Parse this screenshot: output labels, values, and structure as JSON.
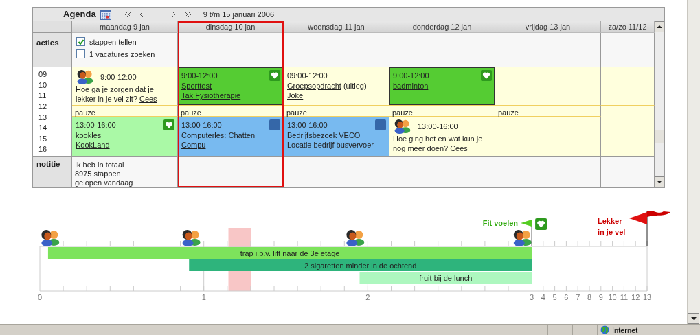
{
  "agenda": {
    "title": "Agenda",
    "range": "9 t/m 15 januari 2006",
    "days": [
      {
        "label": "maandag 9 jan",
        "selected": false
      },
      {
        "label": "dinsdag 10 jan",
        "selected": true
      },
      {
        "label": "woensdag 11 jan",
        "selected": false
      },
      {
        "label": "donderdag 12 jan",
        "selected": false
      },
      {
        "label": "vrijdag 13 jan",
        "selected": false
      },
      {
        "label": "za/zo 11/12",
        "selected": false
      }
    ],
    "actions_label": "acties",
    "actions": [
      {
        "label": "stappen tellen",
        "checked": true
      },
      {
        "label": "1 vacatures zoeken",
        "checked": false
      }
    ],
    "hours": [
      "09",
      "10",
      "11",
      "12",
      "13",
      "14",
      "15",
      "16"
    ],
    "morning": [
      {
        "kind": "note",
        "time": "9:00-12:00",
        "lines": [
          [
            {
              "text": "Hoe ga je zorgen dat je lekker in je vel zit? ",
              "link": false
            },
            {
              "text": "Cees",
              "link": true
            }
          ]
        ]
      },
      {
        "kind": "green",
        "time": "9:00-12:00",
        "lines": [
          [
            {
              "text": "Sporttest",
              "link": true
            }
          ],
          [
            {
              "text": "Tak Fysiotherapie",
              "link": true
            }
          ]
        ]
      },
      {
        "kind": "plain",
        "time": "09:00-12:00",
        "lines": [
          [
            {
              "text": "Groepsopdracht",
              "link": true
            },
            {
              "text": " (uitleg)",
              "link": false
            }
          ],
          [
            {
              "text": "Joke",
              "link": true
            }
          ]
        ]
      },
      {
        "kind": "green",
        "time": "9:00-12:00",
        "lines": [
          [
            {
              "text": "badminton",
              "link": true
            }
          ]
        ]
      },
      {
        "kind": "empty"
      },
      {
        "kind": "empty"
      }
    ],
    "breaks": [
      "pauze",
      "pauze",
      "pauze",
      "pauze",
      "pauze"
    ],
    "afternoon": [
      {
        "kind": "light-green",
        "time": "13:00-16:00",
        "lines": [
          [
            {
              "text": "kookles",
              "link": true
            }
          ],
          [
            {
              "text": "KookLand",
              "link": true
            }
          ]
        ]
      },
      {
        "kind": "blue",
        "time": "13:00-16:00",
        "lines": [
          [
            {
              "text": "Computerles: Chatten",
              "link": true
            }
          ],
          [
            {
              "text": "Compu",
              "link": true
            }
          ]
        ]
      },
      {
        "kind": "blue",
        "time": "13:00-16:00",
        "lines": [
          [
            {
              "text": "Bedrijfsbezoek ",
              "link": false
            },
            {
              "text": "VECO",
              "link": true
            }
          ],
          [
            {
              "text": "Locatie bedrijf busvervoer",
              "link": false
            }
          ]
        ]
      },
      {
        "kind": "note",
        "time": "13:00-16:00",
        "lines": [
          [
            {
              "text": "Hoe ging het en wat kun je nog meer doen? ",
              "link": false
            },
            {
              "text": "Cees",
              "link": true
            }
          ]
        ]
      },
      {
        "kind": "empty"
      },
      {
        "kind": "empty"
      }
    ],
    "notes_label": "notitie",
    "notes": [
      "Ik heb in totaal\n8975 stappen\ngelopen vandaag"
    ]
  },
  "timeline": {
    "ticks": [
      "0",
      "1",
      "2",
      "3",
      "4",
      "5",
      "6",
      "7",
      "8",
      "9",
      "10",
      "11",
      "12",
      "13"
    ],
    "bars": [
      {
        "label": "trap i.p.v. lift naar de 3e etage",
        "color": "#7de35c"
      },
      {
        "label": "2 sigaretten minder in de ochtend",
        "color": "#2eb47c"
      },
      {
        "label": "fruit bij de lunch",
        "color": "#adf7bf"
      }
    ],
    "goals": [
      {
        "kind": "green-flag",
        "lines": [
          "Fit voelen"
        ]
      },
      {
        "kind": "red-flag",
        "lines": [
          "Lekker",
          "in je vel"
        ]
      }
    ]
  },
  "status_bar": {
    "zone": "Internet"
  }
}
